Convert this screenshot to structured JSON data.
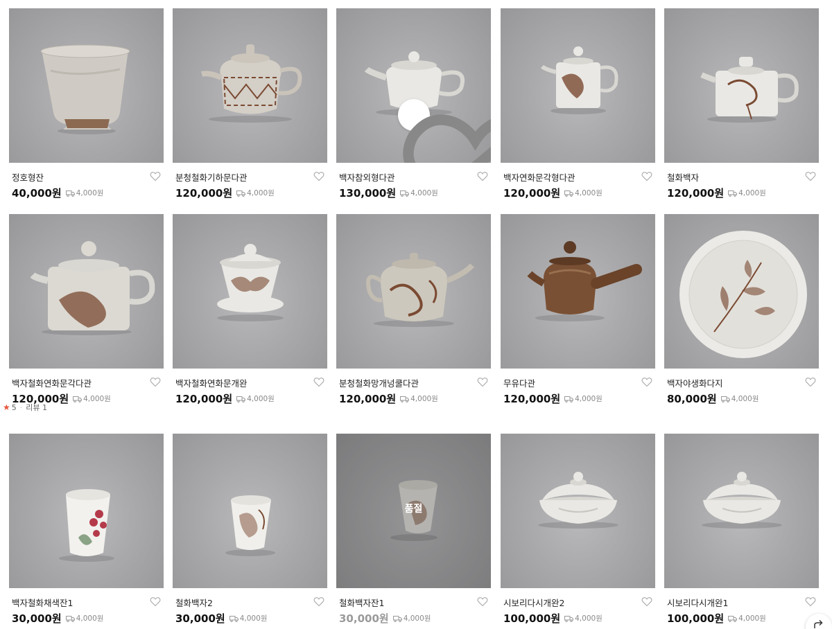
{
  "products": [
    {
      "name": "정호형잔",
      "price": "40,000원",
      "shipping": "4,000원",
      "image": "cup-glazed"
    },
    {
      "name": "분청철화기하문다관",
      "price": "120,000원",
      "shipping": "4,000원",
      "image": "teapot-pattern"
    },
    {
      "name": "백자참외형다관",
      "price": "130,000원",
      "shipping": "4,000원",
      "image": "teapot-white"
    },
    {
      "name": "백자연화문각형다관",
      "price": "120,000원",
      "shipping": "4,000원",
      "image": "teapot-square"
    },
    {
      "name": "철화백자",
      "price": "120,000원",
      "shipping": "4,000원",
      "image": "teapot-square-wide"
    },
    {
      "name": "백자철화연화문각다관",
      "price": "120,000원",
      "shipping": "4,000원",
      "image": "teapot-square-large"
    },
    {
      "name": "백자철화연화문개완",
      "price": "120,000원",
      "shipping": "4,000원",
      "image": "gaiwan"
    },
    {
      "name": "분청철화망개넝쿨다관",
      "price": "120,000원",
      "shipping": "4,000원",
      "image": "teapot-speckled"
    },
    {
      "name": "무유다관",
      "price": "120,000원",
      "shipping": "4,000원",
      "image": "teapot-brown"
    },
    {
      "name": "백자야생화다지",
      "price": "80,000원",
      "shipping": "4,000원",
      "image": "plate"
    },
    {
      "name": "백자철화채색잔1",
      "price": "30,000원",
      "shipping": "4,000원",
      "image": "cup-flower-red"
    },
    {
      "name": "철화백자2",
      "price": "30,000원",
      "shipping": "4,000원",
      "image": "cup-flower-brown"
    },
    {
      "name": "철화백자잔1",
      "price": "30,000원",
      "shipping": "4,000원",
      "image": "cup-soldout"
    },
    {
      "name": "시보리다시개완2",
      "price": "100,000원",
      "shipping": "4,000원",
      "image": "shiboridashi"
    },
    {
      "name": "시보리다시개완1",
      "price": "100,000원",
      "shipping": "4,000원",
      "image": "shiboridashi"
    }
  ],
  "review": {
    "star": "★",
    "score": "5",
    "label": "리뷰 1"
  },
  "soldout_label": "품절",
  "colors": {
    "soldout_price": "#9a9a9a",
    "star": "#e8553d",
    "background": "#ffffff"
  },
  "icons": [
    "wishlist-heart-icon",
    "shipping-truck-icon",
    "share-icon"
  ]
}
